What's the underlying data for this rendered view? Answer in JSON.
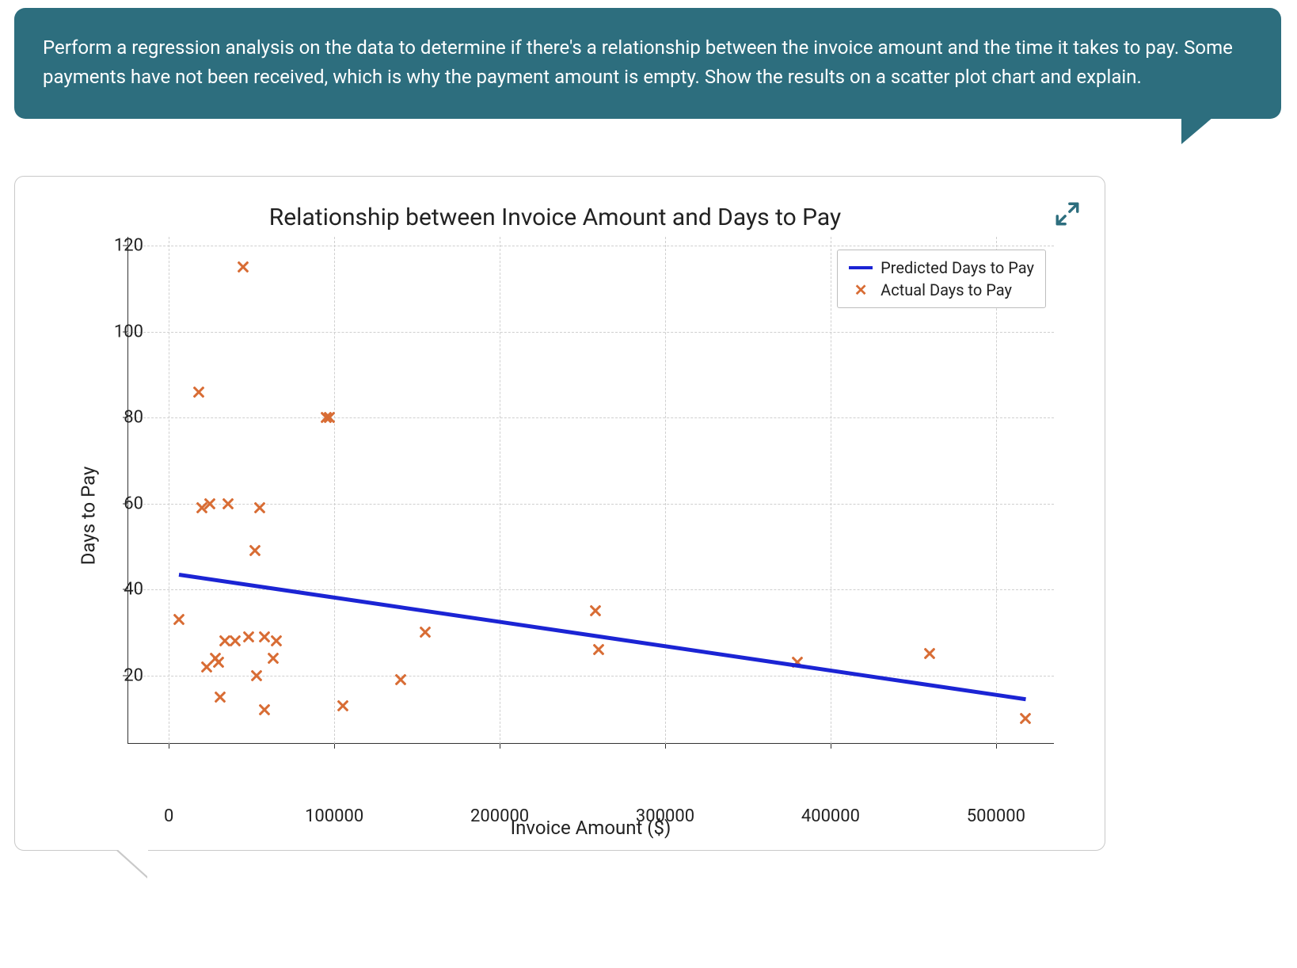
{
  "prompt": {
    "text": "Perform a regression analysis on the data to determine if there's a relationship between the invoice amount and the time it takes to pay. Some payments have not been received, which is why the payment amount is empty. Show the results on a scatter plot chart and explain."
  },
  "chart_data": {
    "type": "scatter",
    "title": "Relationship between Invoice Amount and Days to Pay",
    "xlabel": "Invoice Amount ($)",
    "ylabel": "Days to Pay",
    "xlim": [
      -25000,
      535000
    ],
    "ylim": [
      4,
      122
    ],
    "xticks": [
      0,
      100000,
      200000,
      300000,
      400000,
      500000
    ],
    "yticks": [
      20,
      40,
      60,
      80,
      100,
      120
    ],
    "xtick_labels": [
      "0",
      "100000",
      "200000",
      "300000",
      "400000",
      "500000"
    ],
    "ytick_labels": [
      "20",
      "40",
      "60",
      "80",
      "100",
      "120"
    ],
    "grid": true,
    "legend": {
      "position": "upper right",
      "entries": [
        {
          "name": "Predicted Days to Pay",
          "type": "line",
          "color": "#1b24d4"
        },
        {
          "name": "Actual Days to Pay",
          "type": "marker",
          "marker": "x",
          "color": "#d86c34"
        }
      ]
    },
    "series": [
      {
        "name": "Actual Days to Pay",
        "type": "scatter",
        "marker": "x",
        "points": [
          {
            "x": 6000,
            "y": 33
          },
          {
            "x": 18000,
            "y": 86
          },
          {
            "x": 20000,
            "y": 59
          },
          {
            "x": 23000,
            "y": 22
          },
          {
            "x": 25000,
            "y": 60
          },
          {
            "x": 28000,
            "y": 24
          },
          {
            "x": 30000,
            "y": 23
          },
          {
            "x": 31000,
            "y": 15
          },
          {
            "x": 34000,
            "y": 28
          },
          {
            "x": 36000,
            "y": 60
          },
          {
            "x": 40000,
            "y": 28
          },
          {
            "x": 45000,
            "y": 115
          },
          {
            "x": 48000,
            "y": 29
          },
          {
            "x": 52000,
            "y": 49
          },
          {
            "x": 53000,
            "y": 20
          },
          {
            "x": 55000,
            "y": 59
          },
          {
            "x": 58000,
            "y": 29
          },
          {
            "x": 58000,
            "y": 12
          },
          {
            "x": 63000,
            "y": 24
          },
          {
            "x": 65000,
            "y": 28
          },
          {
            "x": 95000,
            "y": 80
          },
          {
            "x": 97000,
            "y": 80
          },
          {
            "x": 105000,
            "y": 13
          },
          {
            "x": 140000,
            "y": 19
          },
          {
            "x": 155000,
            "y": 30
          },
          {
            "x": 258000,
            "y": 35
          },
          {
            "x": 260000,
            "y": 26
          },
          {
            "x": 380000,
            "y": 23
          },
          {
            "x": 460000,
            "y": 25
          },
          {
            "x": 518000,
            "y": 10
          }
        ]
      },
      {
        "name": "Predicted Days to Pay",
        "type": "line",
        "points": [
          {
            "x": 6000,
            "y": 43.5
          },
          {
            "x": 518000,
            "y": 14.5
          }
        ]
      }
    ]
  },
  "icons": {
    "expand": "expand-icon"
  }
}
